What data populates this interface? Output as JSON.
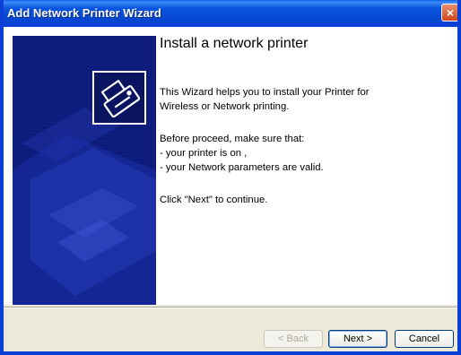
{
  "window": {
    "title": "Add Network Printer Wizard",
    "close_glyph": "×"
  },
  "content": {
    "heading": "Install a network printer",
    "intro_line1": "This Wizard helps you to install your Printer for",
    "intro_line2": "Wireless or Network printing.",
    "before_line": "Before proceed, make sure that:",
    "check1": "- your printer is on ,",
    "check2": "- your Network parameters are valid.",
    "click_next": "Click \"Next\" to continue."
  },
  "buttons": {
    "back": "< Back",
    "next": "Next >",
    "cancel": "Cancel"
  },
  "icons": {
    "printer_icon": "printer-icon",
    "close_icon": "close-icon"
  },
  "colors": {
    "titlebar": "#0a3fd8",
    "panel": "#0d1c7a",
    "close": "#d04818"
  }
}
